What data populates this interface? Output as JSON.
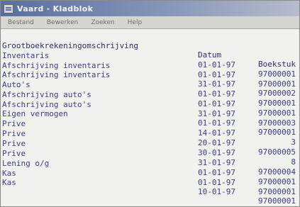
{
  "window": {
    "title": "Vaard - Kladblok"
  },
  "menu": [
    {
      "label": "Bestand"
    },
    {
      "label": "Bewerken"
    },
    {
      "label": "Zoeken"
    },
    {
      "label": "Help"
    }
  ],
  "table": {
    "columns": {
      "description": "Grootboekrekeningomschrijving",
      "date": "Datum",
      "document": "Boekstuk"
    },
    "rows": [
      {
        "description": "Inventaris",
        "date": "01-01-97",
        "document": "97000001"
      },
      {
        "description": "Afschrijving inventaris",
        "date": "01-01-97",
        "document": "97000001"
      },
      {
        "description": "Afschrijving inventaris",
        "date": "31-01-97",
        "document": "97000002"
      },
      {
        "description": "Auto's",
        "date": "01-01-97",
        "document": "97000001"
      },
      {
        "description": "Afschrijving auto's",
        "date": "01-01-97",
        "document": "97000001"
      },
      {
        "description": "Afschrijving auto's",
        "date": "31-01-97",
        "document": "97000003"
      },
      {
        "description": "Eigen vermogen",
        "date": "01-01-97",
        "document": "97000001"
      },
      {
        "description": "Prive",
        "date": "14-01-97",
        "document": "3"
      },
      {
        "description": "Prive",
        "date": "20-01-97",
        "document": "97000005"
      },
      {
        "description": "Prive",
        "date": "30-01-97",
        "document": "8"
      },
      {
        "description": "Prive",
        "date": "31-01-97",
        "document": "97000004"
      },
      {
        "description": "Lening o/g",
        "date": "01-01-97",
        "document": "97000001"
      },
      {
        "description": "Kas",
        "date": "01-01-97",
        "document": "97000001"
      },
      {
        "description": "Kas",
        "date": "10-01-97",
        "document": "97000001"
      }
    ]
  }
}
